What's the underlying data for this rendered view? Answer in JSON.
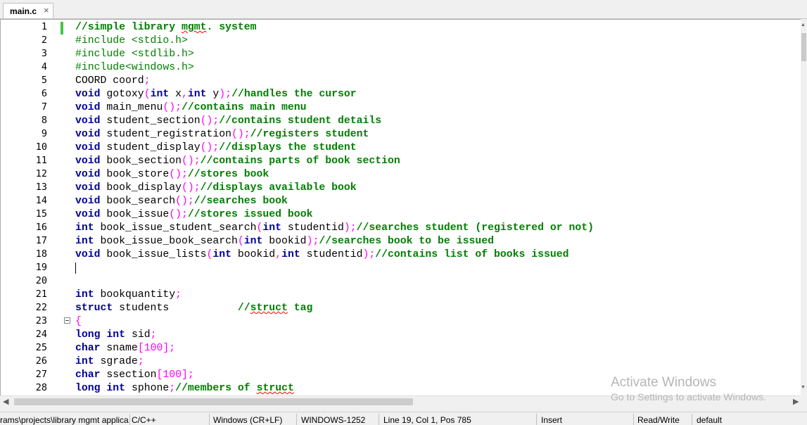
{
  "tab": {
    "title": "main.c",
    "close_icon": "×"
  },
  "lines": [
    {
      "n": "1",
      "segs": [
        [
          "cmt",
          "//simple library "
        ],
        [
          "cmt sq",
          "mgmt"
        ],
        [
          "cmt",
          ". system"
        ]
      ]
    },
    {
      "n": "2",
      "segs": [
        [
          "pp",
          "#include <stdio.h>"
        ]
      ]
    },
    {
      "n": "3",
      "segs": [
        [
          "pp",
          "#include <stdlib.h>"
        ]
      ]
    },
    {
      "n": "4",
      "segs": [
        [
          "pp",
          "#include<windows.h>"
        ]
      ]
    },
    {
      "n": "5",
      "segs": [
        [
          "",
          "COORD coord"
        ],
        [
          "pn",
          ";"
        ]
      ]
    },
    {
      "n": "6",
      "segs": [
        [
          "kw",
          "void"
        ],
        [
          "",
          " gotoxy"
        ],
        [
          "pn",
          "("
        ],
        [
          "kw",
          "int"
        ],
        [
          "",
          " x"
        ],
        [
          "pn",
          ","
        ],
        [
          "kw",
          "int"
        ],
        [
          "",
          " y"
        ],
        [
          "pn",
          ");"
        ],
        [
          "cmt",
          "//handles the cursor"
        ]
      ]
    },
    {
      "n": "7",
      "segs": [
        [
          "kw",
          "void"
        ],
        [
          "",
          " main_menu"
        ],
        [
          "pn",
          "();"
        ],
        [
          "cmt",
          "//contains main menu"
        ]
      ]
    },
    {
      "n": "8",
      "segs": [
        [
          "kw",
          "void"
        ],
        [
          "",
          " student_section"
        ],
        [
          "pn",
          "();"
        ],
        [
          "cmt",
          "//contains student details"
        ]
      ]
    },
    {
      "n": "9",
      "segs": [
        [
          "kw",
          "void"
        ],
        [
          "",
          " student_registration"
        ],
        [
          "pn",
          "();"
        ],
        [
          "cmt",
          "//registers student"
        ]
      ]
    },
    {
      "n": "10",
      "segs": [
        [
          "kw",
          "void"
        ],
        [
          "",
          " student_display"
        ],
        [
          "pn",
          "();"
        ],
        [
          "cmt",
          "//displays the student"
        ]
      ]
    },
    {
      "n": "11",
      "segs": [
        [
          "kw",
          "void"
        ],
        [
          "",
          " book_section"
        ],
        [
          "pn",
          "();"
        ],
        [
          "cmt",
          "//contains parts of book section"
        ]
      ]
    },
    {
      "n": "12",
      "segs": [
        [
          "kw",
          "void"
        ],
        [
          "",
          " book_store"
        ],
        [
          "pn",
          "();"
        ],
        [
          "cmt",
          "//stores book"
        ]
      ]
    },
    {
      "n": "13",
      "segs": [
        [
          "kw",
          "void"
        ],
        [
          "",
          " book_display"
        ],
        [
          "pn",
          "();"
        ],
        [
          "cmt",
          "//displays available book"
        ]
      ]
    },
    {
      "n": "14",
      "segs": [
        [
          "kw",
          "void"
        ],
        [
          "",
          " book_search"
        ],
        [
          "pn",
          "();"
        ],
        [
          "cmt",
          "//searches book"
        ]
      ]
    },
    {
      "n": "15",
      "segs": [
        [
          "kw",
          "void"
        ],
        [
          "",
          " book_issue"
        ],
        [
          "pn",
          "();"
        ],
        [
          "cmt",
          "//stores issued book"
        ]
      ]
    },
    {
      "n": "16",
      "segs": [
        [
          "kw",
          "int"
        ],
        [
          "",
          " book_issue_student_search"
        ],
        [
          "pn",
          "("
        ],
        [
          "kw",
          "int"
        ],
        [
          "",
          " studentid"
        ],
        [
          "pn",
          ");"
        ],
        [
          "cmt",
          "//searches student (registered or not)"
        ]
      ]
    },
    {
      "n": "17",
      "segs": [
        [
          "kw",
          "int"
        ],
        [
          "",
          " book_issue_book_search"
        ],
        [
          "pn",
          "("
        ],
        [
          "kw",
          "int"
        ],
        [
          "",
          " bookid"
        ],
        [
          "pn",
          ");"
        ],
        [
          "cmt",
          "//searches book to be issued"
        ]
      ]
    },
    {
      "n": "18",
      "segs": [
        [
          "kw",
          "void"
        ],
        [
          "",
          " book_issue_lists"
        ],
        [
          "pn",
          "("
        ],
        [
          "kw",
          "int"
        ],
        [
          "",
          " bookid"
        ],
        [
          "pn",
          ","
        ],
        [
          "kw",
          "int"
        ],
        [
          "",
          " studentid"
        ],
        [
          "pn",
          ");"
        ],
        [
          "cmt",
          "//contains list of books issued"
        ]
      ]
    },
    {
      "n": "19",
      "segs": []
    },
    {
      "n": "20",
      "segs": []
    },
    {
      "n": "21",
      "segs": [
        [
          "kw",
          "int"
        ],
        [
          "",
          " bookquantity"
        ],
        [
          "pn",
          ";"
        ]
      ]
    },
    {
      "n": "22",
      "segs": [
        [
          "kw",
          "struct"
        ],
        [
          "",
          " students           "
        ],
        [
          "cmt",
          "//"
        ],
        [
          "cmt sq",
          "struct"
        ],
        [
          "cmt",
          " tag"
        ]
      ]
    },
    {
      "n": "23",
      "segs": [
        [
          "pn",
          "{"
        ]
      ]
    },
    {
      "n": "24",
      "segs": [
        [
          "kw",
          "long"
        ],
        [
          "",
          " "
        ],
        [
          "kw",
          "int"
        ],
        [
          "",
          " sid"
        ],
        [
          "pn",
          ";"
        ]
      ]
    },
    {
      "n": "25",
      "segs": [
        [
          "kw",
          "char"
        ],
        [
          "",
          " sname"
        ],
        [
          "pn",
          "["
        ],
        [
          "num",
          "100"
        ],
        [
          "pn",
          "];"
        ]
      ]
    },
    {
      "n": "26",
      "segs": [
        [
          "kw",
          "int"
        ],
        [
          "",
          " sgrade"
        ],
        [
          "pn",
          ";"
        ]
      ]
    },
    {
      "n": "27",
      "segs": [
        [
          "kw",
          "char"
        ],
        [
          "",
          " ssection"
        ],
        [
          "pn",
          "["
        ],
        [
          "num",
          "100"
        ],
        [
          "pn",
          "];"
        ]
      ]
    },
    {
      "n": "28",
      "segs": [
        [
          "kw",
          "long"
        ],
        [
          "",
          " "
        ],
        [
          "kw",
          "int"
        ],
        [
          "",
          " sphone"
        ],
        [
          "pn",
          ";"
        ],
        [
          "cmt",
          "//members of "
        ],
        [
          "cmt sq",
          "struct"
        ]
      ]
    }
  ],
  "colors": {
    "keyword": "#00009c",
    "comment": "#008000",
    "operator": "#ff00ff",
    "change_bar": "#47c247"
  },
  "watermark": {
    "title": "Activate Windows",
    "subtitle": "Go to Settings to activate Windows."
  },
  "statusbar": {
    "path": "rams\\projects\\library mgmt applica",
    "language": "C/C++",
    "eol": "Windows (CR+LF)",
    "encoding": "WINDOWS-1252",
    "position": "Line 19, Col 1, Pos 785",
    "mode": "Insert",
    "access": "Read/Write",
    "scheme": "default"
  },
  "icons": {
    "scroll_left": "◀",
    "scroll_right": "▶",
    "scroll_up": "▲",
    "scroll_down": "▼"
  }
}
